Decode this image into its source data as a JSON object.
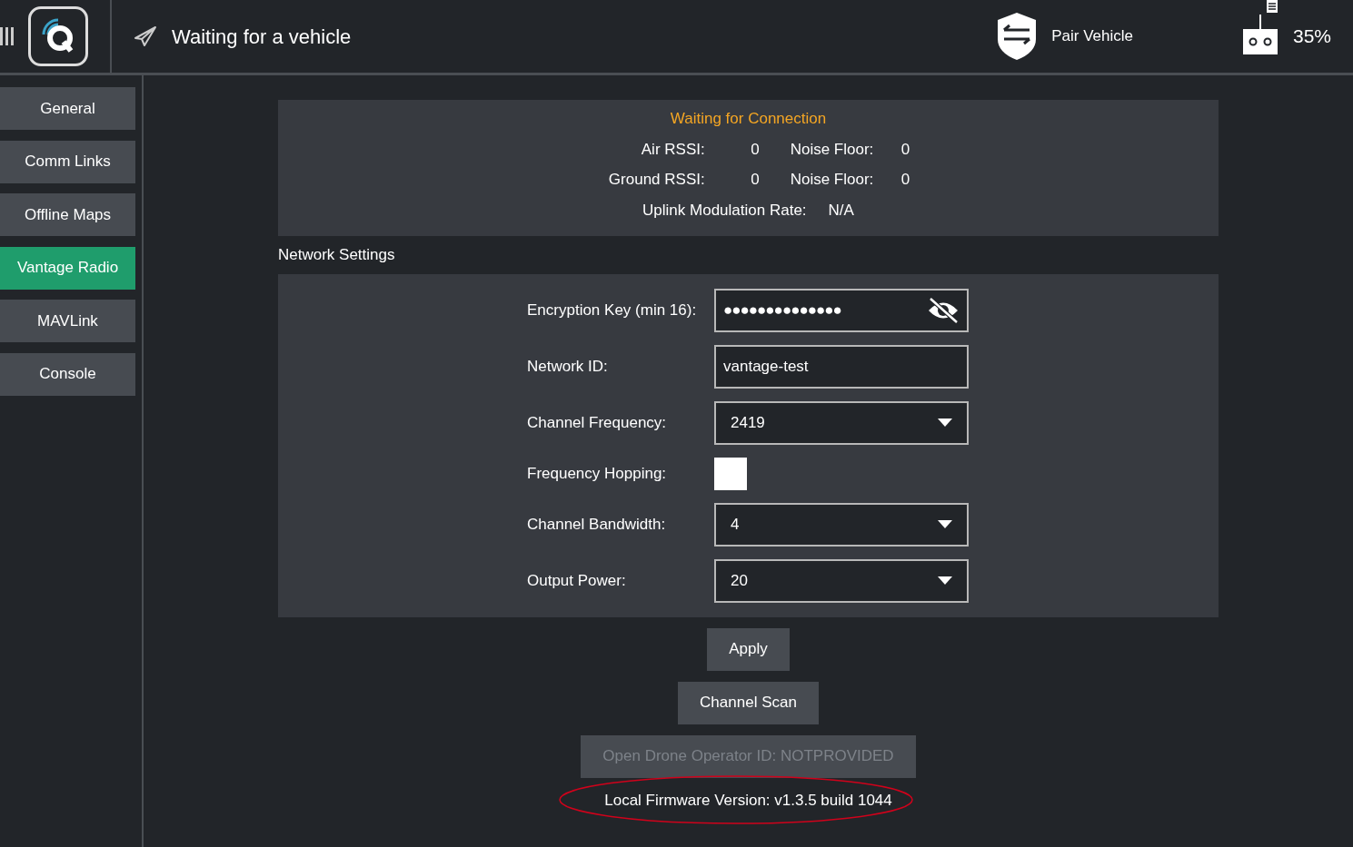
{
  "header": {
    "status": "Waiting for a vehicle",
    "pair_label": "Pair Vehicle",
    "battery": "35%"
  },
  "sidebar": {
    "items": [
      {
        "label": "General",
        "selected": false
      },
      {
        "label": "Comm Links",
        "selected": false
      },
      {
        "label": "Offline Maps",
        "selected": false
      },
      {
        "label": "Vantage Radio",
        "selected": true
      },
      {
        "label": "MAVLink",
        "selected": false
      },
      {
        "label": "Console",
        "selected": false
      }
    ]
  },
  "status_panel": {
    "title": "Waiting for Connection",
    "rows": [
      [
        {
          "label": "Air RSSI:",
          "value": "0"
        },
        {
          "label": "Noise Floor:",
          "value": "0"
        }
      ],
      [
        {
          "label": "Ground RSSI:",
          "value": "0"
        },
        {
          "label": "Noise Floor:",
          "value": "0"
        }
      ]
    ],
    "uplink": {
      "label": "Uplink Modulation Rate:",
      "value": "N/A"
    }
  },
  "network_settings": {
    "title": "Network Settings",
    "fields": [
      {
        "kind": "secret",
        "label": "Encryption Key (min 16):",
        "value": "●●●●●●●●●●●●●●"
      },
      {
        "kind": "text",
        "label": "Network ID:",
        "value": "vantage-test"
      },
      {
        "kind": "select",
        "label": "Channel Frequency:",
        "value": "2419"
      },
      {
        "kind": "checkbox",
        "label": "Frequency Hopping:",
        "checked": false
      },
      {
        "kind": "select",
        "label": "Channel Bandwidth:",
        "value": "4"
      },
      {
        "kind": "select",
        "label": "Output Power:",
        "value": "20"
      }
    ]
  },
  "buttons": [
    {
      "label": "Apply",
      "disabled": false
    },
    {
      "label": "Channel Scan",
      "disabled": false
    },
    {
      "label": "Open Drone Operator ID: NOTPROVIDED",
      "disabled": true
    }
  ],
  "firmware": {
    "text": "Local Firmware Version: v1.3.5 build 1044",
    "circled": true
  }
}
